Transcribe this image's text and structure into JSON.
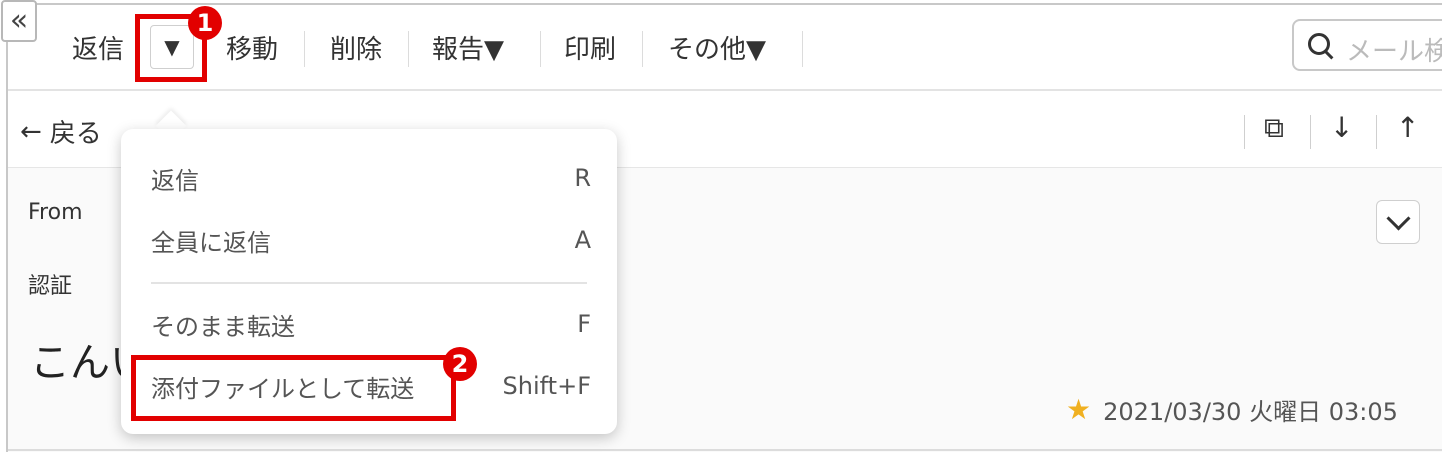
{
  "toolbar": {
    "collapse_glyph": "«",
    "reply": "返信",
    "reply_caret": "▼",
    "move": "移動",
    "delete": "削除",
    "report": "報告▼",
    "print": "印刷",
    "more": "その他▼",
    "search_placeholder": "メール検"
  },
  "nav": {
    "back": "戻る",
    "back_arrow": "←",
    "open_external": "⧉",
    "next": "↓",
    "prev": "↑"
  },
  "mail": {
    "from_label": "From",
    "auth_label": "認証",
    "subject": "こんい",
    "date": "2021/03/30 火曜日 03:05",
    "star": "★"
  },
  "menu": {
    "items": [
      {
        "label": "返信",
        "shortcut": "R"
      },
      {
        "label": "全員に返信",
        "shortcut": "A"
      },
      {
        "label": "そのまま転送",
        "shortcut": "F"
      },
      {
        "label": "添付ファイルとして転送",
        "shortcut": "Shift+F"
      }
    ]
  },
  "annotations": {
    "badge1": "1",
    "badge2": "2"
  },
  "colors": {
    "highlight": "#e20000",
    "star": "#f0b020"
  }
}
